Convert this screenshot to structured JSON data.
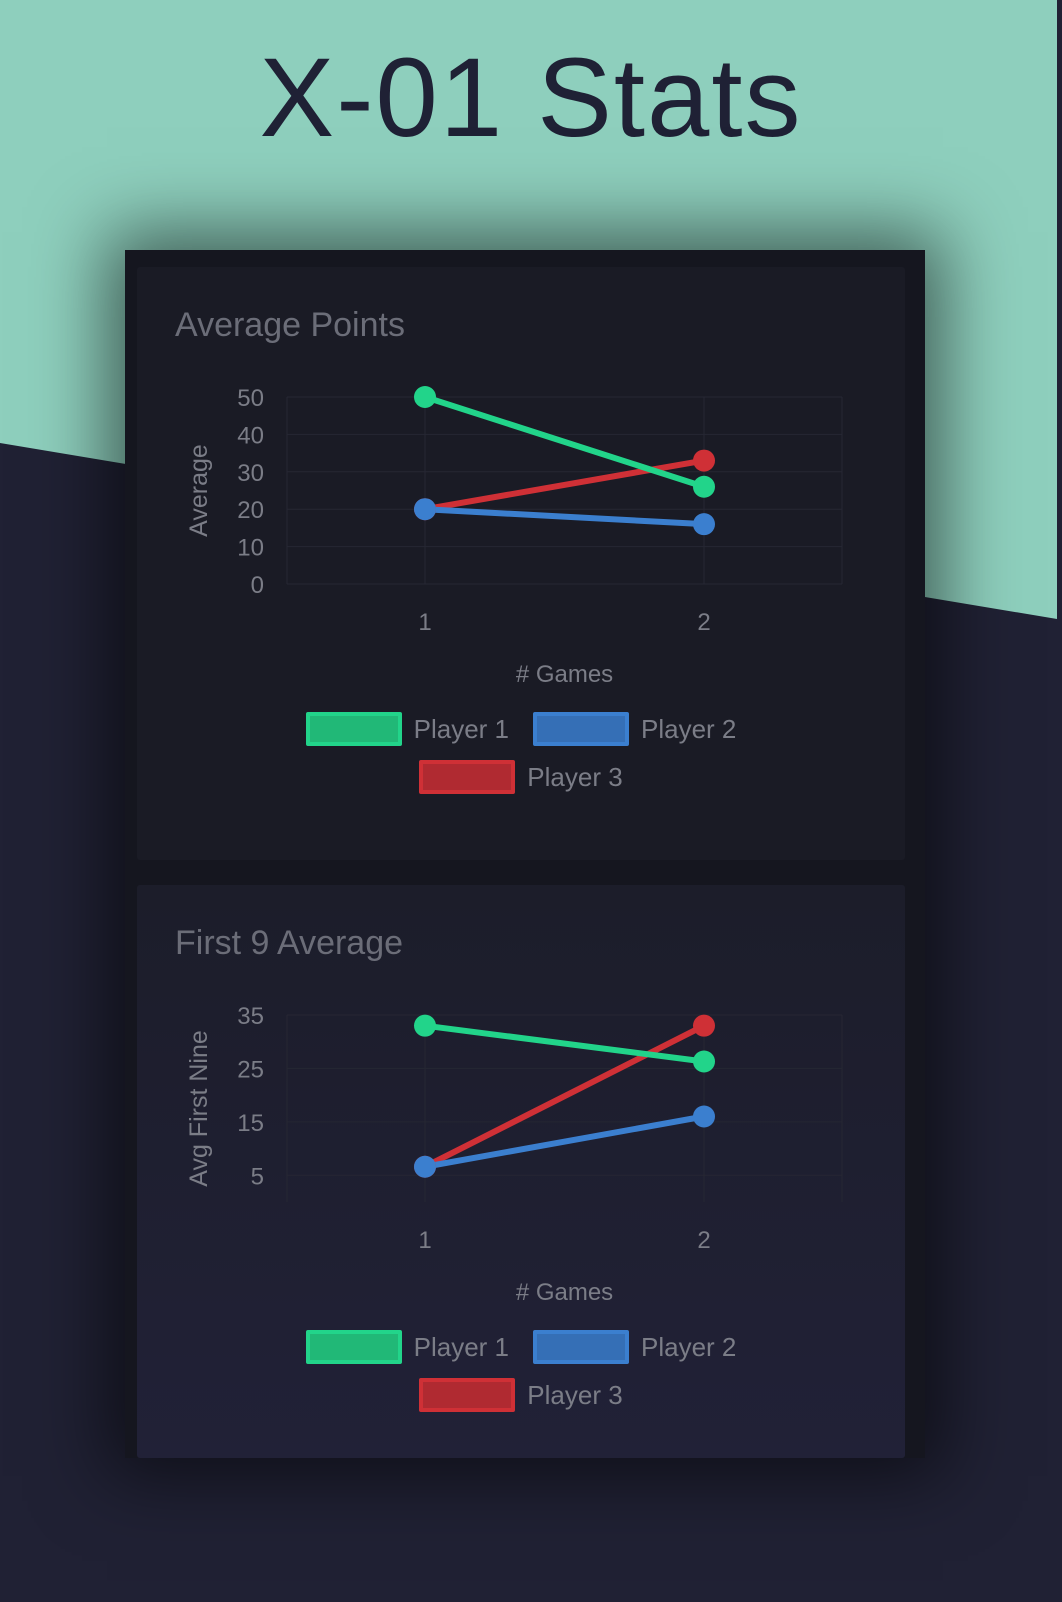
{
  "page": {
    "title": "X-01 Stats"
  },
  "colors": {
    "mint": "#8ecfbd",
    "dark_bg": "#202134",
    "player1": "#22d48a",
    "player2": "#3b7fcf",
    "player3": "#cf3036"
  },
  "chart_data": [
    {
      "type": "line",
      "title": "Average Points",
      "xlabel": "# Games",
      "ylabel": "Average",
      "x": [
        "1",
        "2"
      ],
      "ylim": [
        0,
        50
      ],
      "yticks": [
        "0",
        "10",
        "20",
        "30",
        "40",
        "50"
      ],
      "grid": true,
      "legend": "bottom",
      "series": [
        {
          "name": "Player 1",
          "color": "#22d48a",
          "values": [
            50,
            26
          ]
        },
        {
          "name": "Player 2",
          "color": "#3b7fcf",
          "values": [
            20,
            16
          ]
        },
        {
          "name": "Player 3",
          "color": "#cf3036",
          "values": [
            20,
            33
          ]
        }
      ]
    },
    {
      "type": "line",
      "title": "First 9 Average",
      "xlabel": "# Games",
      "ylabel": "Avg First Nine",
      "x": [
        "1",
        "2"
      ],
      "ylim": [
        0,
        35
      ],
      "yticks": [
        "5",
        "15",
        "25",
        "35"
      ],
      "grid": true,
      "legend": "bottom",
      "series": [
        {
          "name": "Player 1",
          "color": "#22d48a",
          "values": [
            33,
            26.3
          ]
        },
        {
          "name": "Player 2",
          "color": "#3b7fcf",
          "values": [
            6.6,
            16
          ]
        },
        {
          "name": "Player 3",
          "color": "#cf3036",
          "values": [
            6.6,
            33
          ]
        }
      ]
    }
  ]
}
